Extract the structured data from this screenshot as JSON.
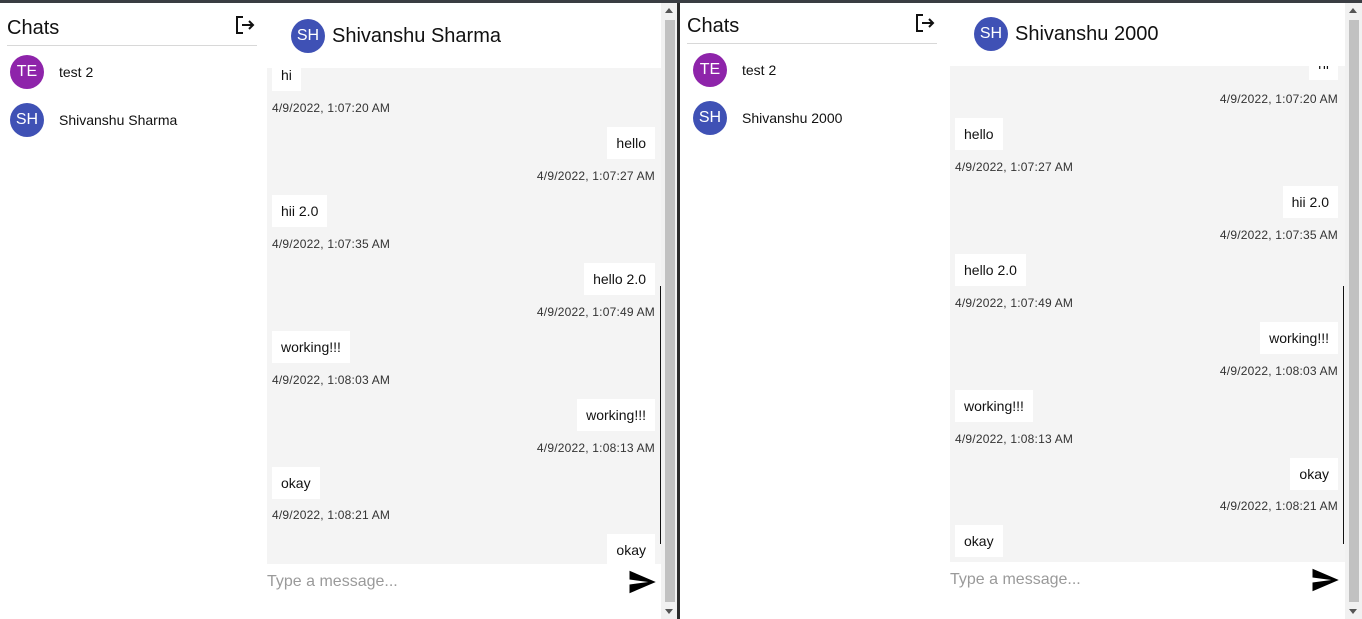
{
  "left": {
    "sidebar": {
      "title": "Chats",
      "contacts": [
        {
          "initials": "TE",
          "name": "test 2",
          "color": "#8e24aa"
        },
        {
          "initials": "SH",
          "name": "Shivanshu Sharma",
          "color": "#3f51b5"
        }
      ]
    },
    "chat": {
      "header": {
        "initials": "SH",
        "name": "Shivanshu Sharma",
        "color": "#3f51b5"
      },
      "messages": [
        {
          "text": "hi",
          "time": "4/9/2022, 1:07:20 AM",
          "side": "in"
        },
        {
          "text": "hello",
          "time": "4/9/2022, 1:07:27 AM",
          "side": "out"
        },
        {
          "text": "hii 2.0",
          "time": "4/9/2022, 1:07:35 AM",
          "side": "in"
        },
        {
          "text": "hello 2.0",
          "time": "4/9/2022, 1:07:49 AM",
          "side": "out"
        },
        {
          "text": "working!!!",
          "time": "4/9/2022, 1:08:03 AM",
          "side": "in"
        },
        {
          "text": "working!!!",
          "time": "4/9/2022, 1:08:13 AM",
          "side": "out"
        },
        {
          "text": "okay",
          "time": "4/9/2022, 1:08:21 AM",
          "side": "in"
        },
        {
          "text": "okay",
          "time": "",
          "side": "out"
        }
      ],
      "placeholder": "Type a message..."
    }
  },
  "right": {
    "sidebar": {
      "title": "Chats",
      "contacts": [
        {
          "initials": "TE",
          "name": "test 2",
          "color": "#8e24aa"
        },
        {
          "initials": "SH",
          "name": "Shivanshu 2000",
          "color": "#3f51b5"
        }
      ]
    },
    "chat": {
      "header": {
        "initials": "SH",
        "name": "Shivanshu 2000",
        "color": "#3f51b5"
      },
      "messages": [
        {
          "text": "hi",
          "time": "4/9/2022, 1:07:20 AM",
          "side": "out"
        },
        {
          "text": "hello",
          "time": "4/9/2022, 1:07:27 AM",
          "side": "in"
        },
        {
          "text": "hii 2.0",
          "time": "4/9/2022, 1:07:35 AM",
          "side": "out"
        },
        {
          "text": "hello 2.0",
          "time": "4/9/2022, 1:07:49 AM",
          "side": "in"
        },
        {
          "text": "working!!!",
          "time": "4/9/2022, 1:08:03 AM",
          "side": "out"
        },
        {
          "text": "working!!!",
          "time": "4/9/2022, 1:08:13 AM",
          "side": "in"
        },
        {
          "text": "okay",
          "time": "4/9/2022, 1:08:21 AM",
          "side": "out"
        },
        {
          "text": "okay",
          "time": "",
          "side": "in"
        }
      ],
      "placeholder": "Type a message..."
    }
  },
  "colors": {
    "message_area": "#f4f4f4",
    "avatar_te": "#8e24aa",
    "avatar_sh": "#3f51b5"
  }
}
